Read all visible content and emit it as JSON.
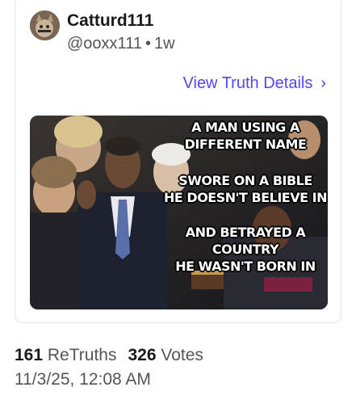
{
  "post": {
    "author_name": "Catturd111",
    "handle": "@ooxx111",
    "separator": "•",
    "age": "1w",
    "details_link": "View Truth Details",
    "details_chevron": "›"
  },
  "meme": {
    "block1": [
      "A MAN USING A",
      "DIFFERENT NAME"
    ],
    "block2": [
      "SWORE ON A BIBLE",
      "HE DOESN'T BELIEVE IN"
    ],
    "block3": [
      "AND BETRAYED A COUNTRY",
      "HE WASN'T BORN IN"
    ]
  },
  "stats": {
    "retruths_count": "161",
    "retruths_label": "ReTruths",
    "votes_count": "326",
    "votes_label": "Votes",
    "timestamp": "11/3/25, 12:08 AM"
  },
  "colors": {
    "link": "#5448ee",
    "muted": "#555555",
    "border": "#e3e3e8"
  }
}
